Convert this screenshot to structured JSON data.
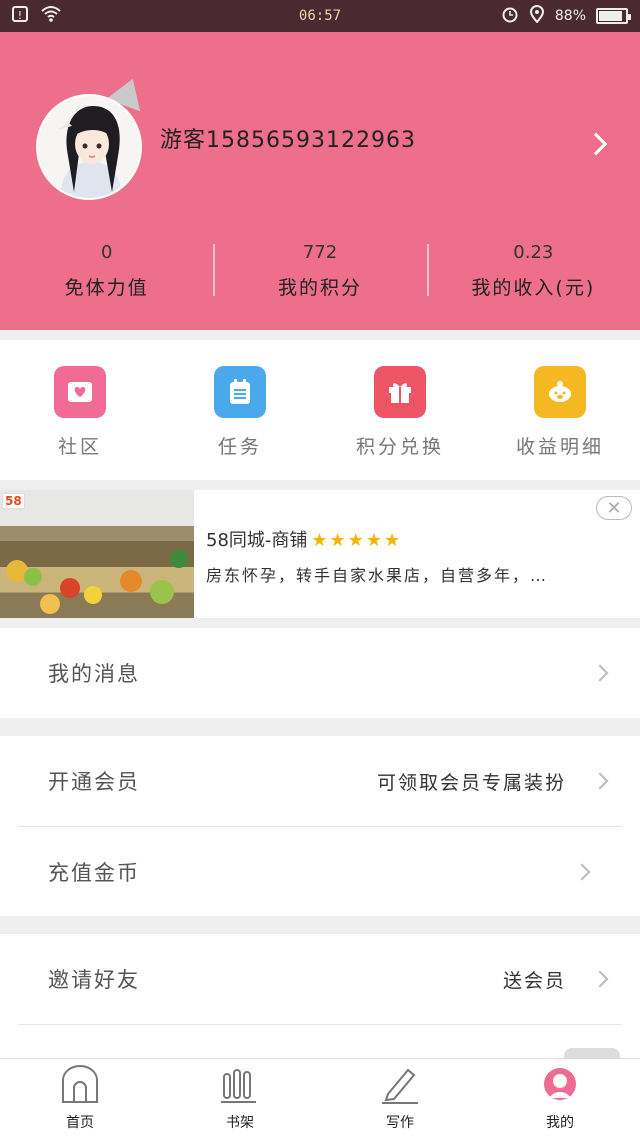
{
  "status_bar": {
    "time": "06:57",
    "battery": "88%",
    "battery_level": 0.88
  },
  "profile": {
    "username": "游客15856593122963"
  },
  "stats": [
    {
      "value": "0",
      "label": "免体力值"
    },
    {
      "value": "772",
      "label": "我的积分"
    },
    {
      "value": "0.23",
      "label": "我的收入(元)"
    }
  ],
  "shortcuts": [
    {
      "label": "社区",
      "icon": "community-icon",
      "color": "#f06b95"
    },
    {
      "label": "任务",
      "icon": "task-icon",
      "color": "#4aa8ec"
    },
    {
      "label": "积分兑换",
      "icon": "gift-icon",
      "color": "#ee5464"
    },
    {
      "label": "收益明细",
      "icon": "piggy-bank-icon",
      "color": "#f5b822"
    }
  ],
  "ad": {
    "badge": "58",
    "title": "58同城-商铺",
    "stars": "★★★★★",
    "description": "房东怀孕，转手自家水果店，自营多年，…",
    "close": "✕"
  },
  "menu": {
    "messages": "我的消息",
    "vip": "开通会员",
    "vip_value": "可领取会员专属装扮",
    "recharge": "充值金币",
    "invite": "邀请好友",
    "invite_value": "送会员"
  },
  "tabs": [
    {
      "label": "首页",
      "icon": "home-icon"
    },
    {
      "label": "书架",
      "icon": "bookshelf-icon"
    },
    {
      "label": "写作",
      "icon": "pencil-icon"
    },
    {
      "label": "我的",
      "icon": "profile-icon",
      "active_color": "#ef6b93"
    }
  ]
}
